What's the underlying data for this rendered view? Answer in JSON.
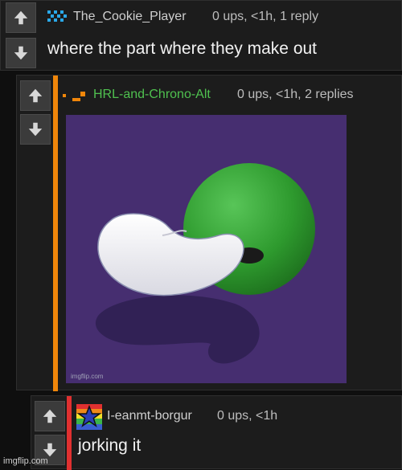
{
  "comments": [
    {
      "username": "The_Cookie_Player",
      "meta": "0 ups, <1h, 1 reply",
      "text": "where the part where they make out",
      "username_color": "#cfcfcf"
    },
    {
      "username": "HRL-and-Chrono-Alt",
      "meta": "0 ups, <1h, 2 replies",
      "username_color": "#4fc04f",
      "accent_color": "#f0860a",
      "image_watermark": "imgflip.com"
    },
    {
      "username": "I-eanmt-borgur",
      "meta": "0 ups, <1h",
      "text": "jorking it",
      "username_color": "#cfcfcf",
      "accent_color": "#e03030"
    }
  ],
  "icons": {
    "upvote": "arrow-up-icon",
    "downvote": "arrow-down-icon"
  },
  "footer": {
    "watermark": "imgflip.com"
  }
}
